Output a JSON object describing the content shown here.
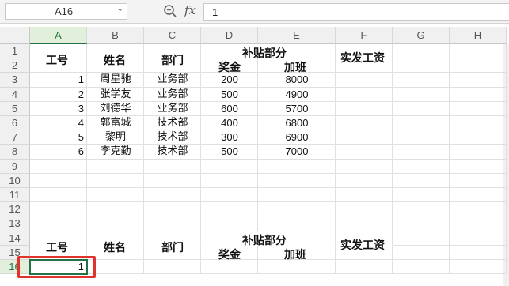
{
  "toolbar": {
    "name_box": "A16",
    "fx_label": "fx",
    "formula_value": "1"
  },
  "columns": [
    "A",
    "B",
    "C",
    "D",
    "E",
    "F",
    "G",
    "H"
  ],
  "rows": [
    "1",
    "2",
    "3",
    "4",
    "5",
    "6",
    "7",
    "8",
    "9",
    "10",
    "11",
    "12",
    "13",
    "14",
    "15",
    "16"
  ],
  "table1": {
    "h_id": "工号",
    "h_name": "姓名",
    "h_dept": "部门",
    "h_sub": "补贴部分",
    "h_bonus": "奖金",
    "h_extra": "加班",
    "h_pay": "实发工资",
    "records": [
      {
        "id": "1",
        "name": "周星驰",
        "dept": "业务部",
        "bonus": "200",
        "extra": "8000"
      },
      {
        "id": "2",
        "name": "张学友",
        "dept": "业务部",
        "bonus": "500",
        "extra": "4900"
      },
      {
        "id": "3",
        "name": "刘德华",
        "dept": "业务部",
        "bonus": "600",
        "extra": "5700"
      },
      {
        "id": "4",
        "name": "郭富城",
        "dept": "技术部",
        "bonus": "400",
        "extra": "6800"
      },
      {
        "id": "5",
        "name": "黎明",
        "dept": "技术部",
        "bonus": "300",
        "extra": "6900"
      },
      {
        "id": "6",
        "name": "李克勤",
        "dept": "技术部",
        "bonus": "500",
        "extra": "7000"
      }
    ]
  },
  "table2": {
    "h_id": "工号",
    "h_name": "姓名",
    "h_dept": "部门",
    "h_sub": "补贴部分",
    "h_bonus": "奖金",
    "h_extra": "加班",
    "h_pay": "实发工资",
    "active_value": "1"
  },
  "colors": {
    "accent": "#217346",
    "highlight": "#e0332b"
  }
}
